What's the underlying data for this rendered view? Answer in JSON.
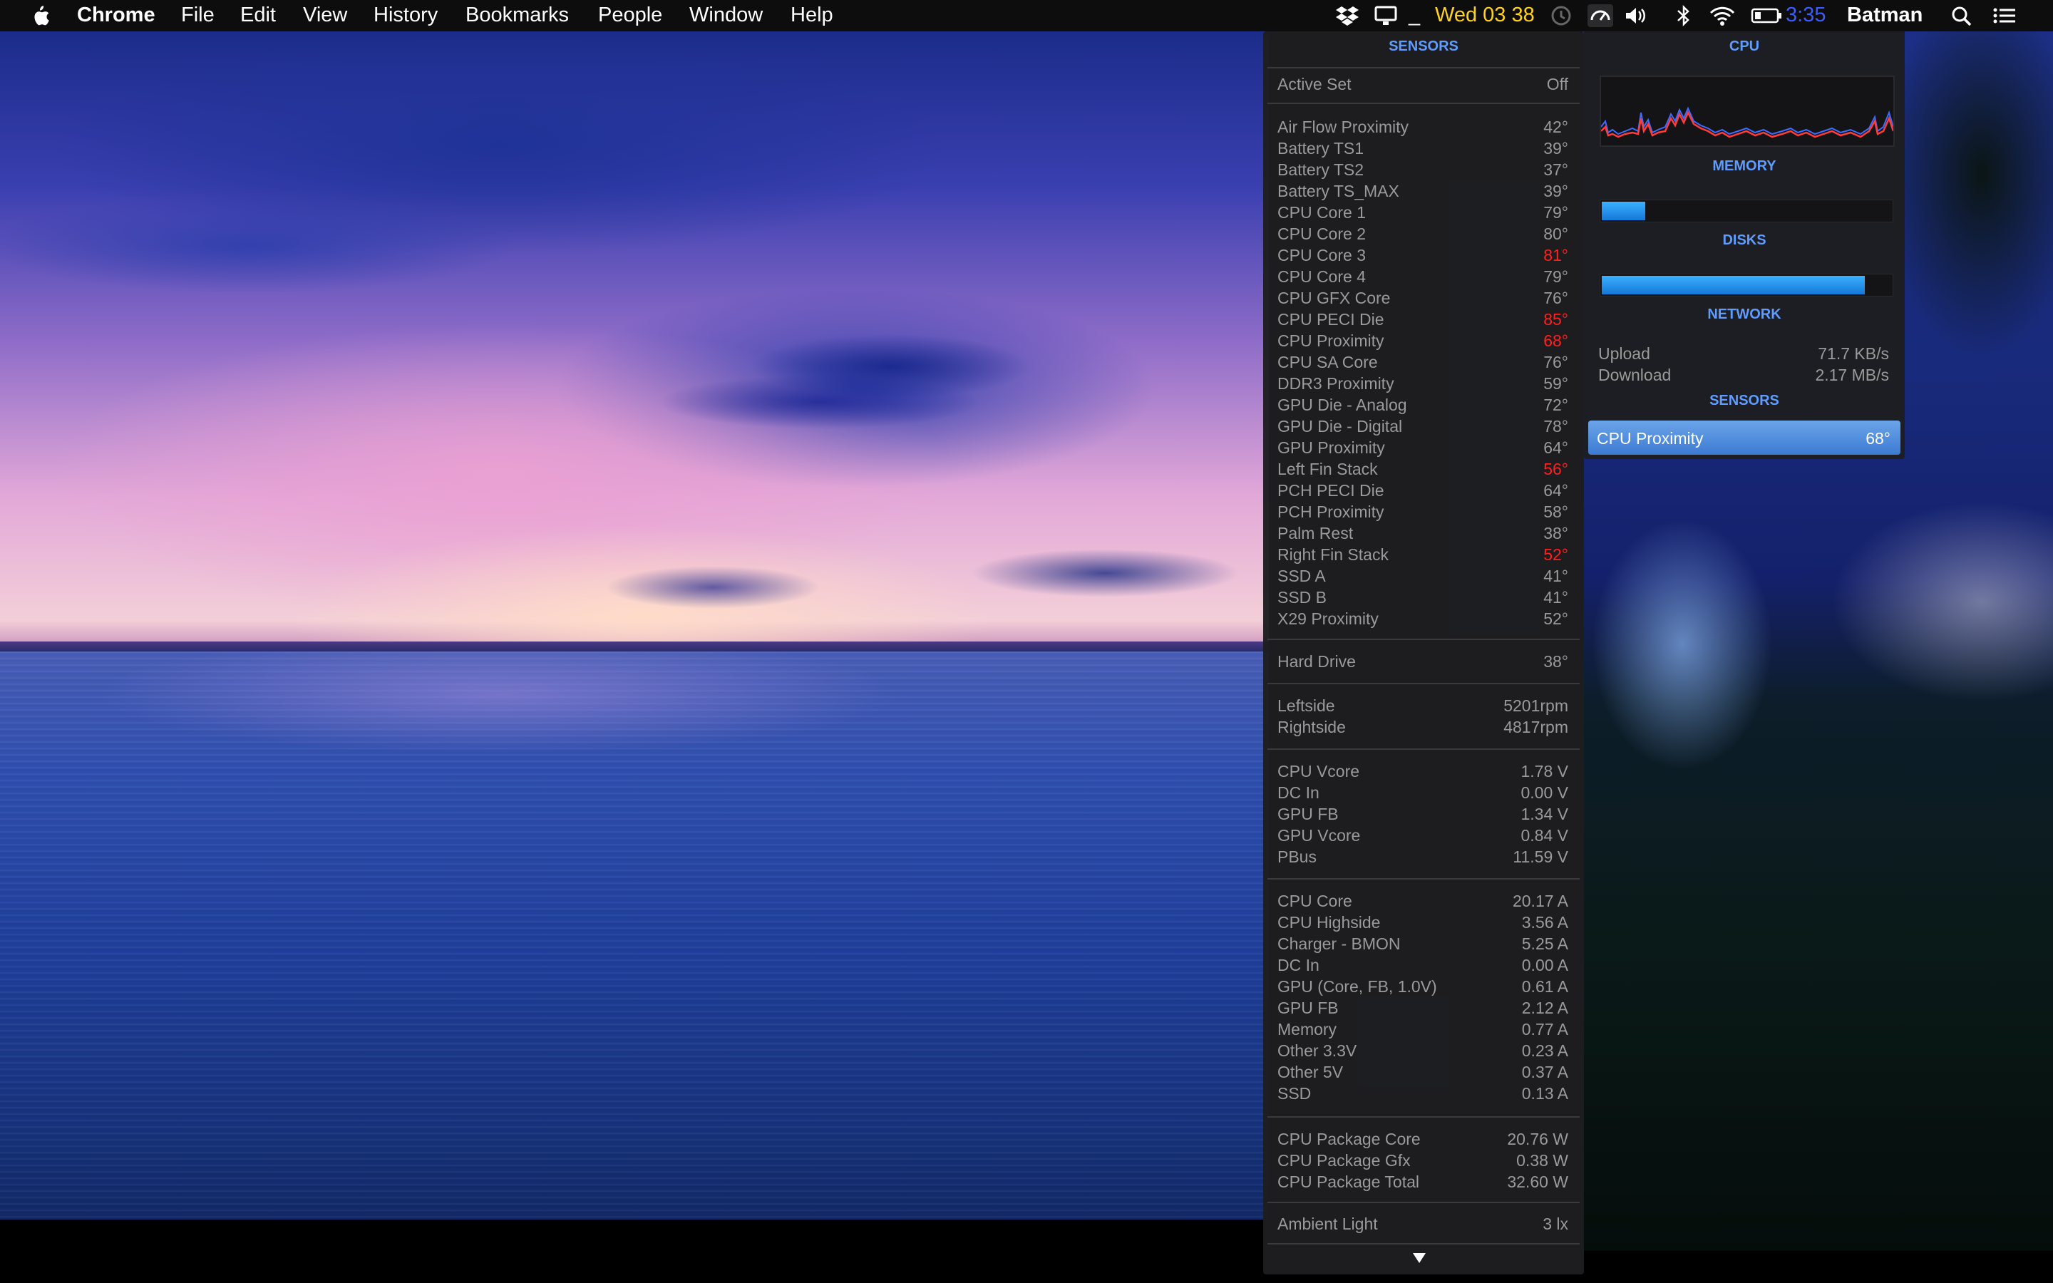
{
  "menubar": {
    "app": "Chrome",
    "menus": [
      "File",
      "Edit",
      "View",
      "History",
      "Bookmarks",
      "People",
      "Window",
      "Help"
    ],
    "clock": "Wed 03 38",
    "battery_time": "3:35",
    "user": "Batman",
    "dash": "_"
  },
  "sensors_panel": {
    "title": "SENSORS",
    "active_set": {
      "label": "Active Set",
      "value": "Off"
    },
    "temperatures": [
      {
        "label": "Air Flow Proximity",
        "value": "42°",
        "hot": false
      },
      {
        "label": "Battery TS1",
        "value": "39°",
        "hot": false
      },
      {
        "label": "Battery TS2",
        "value": "37°",
        "hot": false
      },
      {
        "label": "Battery TS_MAX",
        "value": "39°",
        "hot": false
      },
      {
        "label": "CPU Core 1",
        "value": "79°",
        "hot": false
      },
      {
        "label": "CPU Core 2",
        "value": "80°",
        "hot": false
      },
      {
        "label": "CPU Core 3",
        "value": "81°",
        "hot": true
      },
      {
        "label": "CPU Core 4",
        "value": "79°",
        "hot": false
      },
      {
        "label": "CPU GFX Core",
        "value": "76°",
        "hot": false
      },
      {
        "label": "CPU PECI Die",
        "value": "85°",
        "hot": true
      },
      {
        "label": "CPU Proximity",
        "value": "68°",
        "hot": true
      },
      {
        "label": "CPU SA Core",
        "value": "76°",
        "hot": false
      },
      {
        "label": "DDR3 Proximity",
        "value": "59°",
        "hot": false
      },
      {
        "label": "GPU Die - Analog",
        "value": "72°",
        "hot": false
      },
      {
        "label": "GPU Die - Digital",
        "value": "78°",
        "hot": false
      },
      {
        "label": "GPU Proximity",
        "value": "64°",
        "hot": false
      },
      {
        "label": "Left Fin Stack",
        "value": "56°",
        "hot": true
      },
      {
        "label": "PCH PECI Die",
        "value": "64°",
        "hot": false
      },
      {
        "label": "PCH Proximity",
        "value": "58°",
        "hot": false
      },
      {
        "label": "Palm Rest",
        "value": "38°",
        "hot": false
      },
      {
        "label": "Right Fin Stack",
        "value": "52°",
        "hot": true
      },
      {
        "label": "SSD A",
        "value": "41°",
        "hot": false
      },
      {
        "label": "SSD B",
        "value": "41°",
        "hot": false
      },
      {
        "label": "X29 Proximity",
        "value": "52°",
        "hot": false
      }
    ],
    "hard_drive": {
      "label": "Hard Drive",
      "value": "38°"
    },
    "fans": [
      {
        "label": "Leftside",
        "value": "5201rpm"
      },
      {
        "label": "Rightside",
        "value": "4817rpm"
      }
    ],
    "voltages": [
      {
        "label": "CPU Vcore",
        "value": "1.78 V"
      },
      {
        "label": "DC In",
        "value": "0.00 V"
      },
      {
        "label": "GPU FB",
        "value": "1.34 V"
      },
      {
        "label": "GPU Vcore",
        "value": "0.84 V"
      },
      {
        "label": "PBus",
        "value": "11.59 V"
      }
    ],
    "currents": [
      {
        "label": "CPU Core",
        "value": "20.17 A"
      },
      {
        "label": "CPU Highside",
        "value": "3.56 A"
      },
      {
        "label": "Charger - BMON",
        "value": "5.25 A"
      },
      {
        "label": "DC In",
        "value": "0.00 A"
      },
      {
        "label": "GPU (Core, FB, 1.0V)",
        "value": "0.61 A"
      },
      {
        "label": "GPU FB",
        "value": "2.12 A"
      },
      {
        "label": "Memory",
        "value": "0.77 A"
      },
      {
        "label": "Other 3.3V",
        "value": "0.23 A"
      },
      {
        "label": "Other 5V",
        "value": "0.37 A"
      },
      {
        "label": "SSD",
        "value": "0.13 A"
      }
    ],
    "power": [
      {
        "label": "CPU Package Core",
        "value": "20.76 W"
      },
      {
        "label": "CPU Package Gfx",
        "value": "0.38 W"
      },
      {
        "label": "CPU Package Total",
        "value": "32.60 W"
      }
    ],
    "ambient": {
      "label": "Ambient Light",
      "value": "3 lx"
    }
  },
  "summary_panel": {
    "cpu_title": "CPU",
    "memory_title": "MEMORY",
    "memory_fraction": 0.15,
    "disks_title": "DISKS",
    "disks_fraction": 0.91,
    "network_title": "NETWORK",
    "upload": {
      "label": "Upload",
      "value": "71.7 KB/s"
    },
    "download": {
      "label": "Download",
      "value": "2.17 MB/s"
    },
    "sensors_title": "SENSORS",
    "selected_sensor": {
      "label": "CPU Proximity",
      "value": "68°"
    }
  },
  "colors": {
    "accent_header": "#5f9cff",
    "hot_value": "#ff2020",
    "clock_yellow": "#ffd21f",
    "battery_time_blue": "#3b5cff",
    "bar_blue": "#1e90ff"
  }
}
